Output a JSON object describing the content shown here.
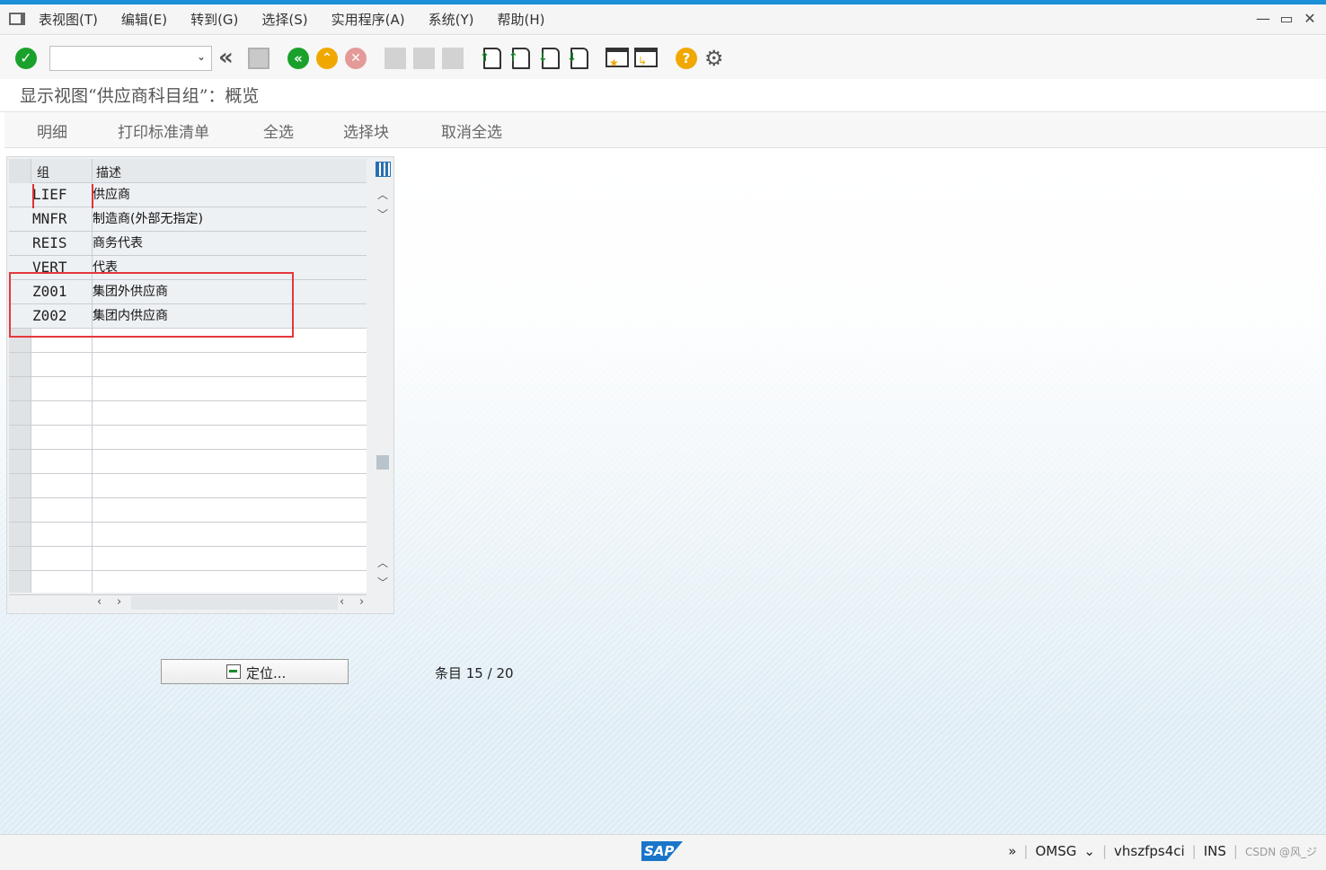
{
  "menubar": {
    "items": [
      "表视图(T)",
      "编辑(E)",
      "转到(G)",
      "选择(S)",
      "实用程序(A)",
      "系统(Y)",
      "帮助(H)"
    ],
    "window_controls": [
      "—",
      "▭",
      "✕"
    ]
  },
  "toolbar": {
    "command_field": {
      "value": "",
      "placeholder": ""
    }
  },
  "title": "显示视图“供应商科目组”：概览",
  "app_toolbar": {
    "buttons": [
      "明细",
      "打印标准清单",
      "全选",
      "选择块",
      "取消全选"
    ]
  },
  "table": {
    "columns": [
      "组",
      "描述"
    ],
    "rows": [
      {
        "group": "LIEF",
        "desc": "供应商"
      },
      {
        "group": "MNFR",
        "desc": "制造商(外部无指定)"
      },
      {
        "group": "REIS",
        "desc": "商务代表"
      },
      {
        "group": "VERT",
        "desc": "代表"
      },
      {
        "group": "Z001",
        "desc": "集团外供应商"
      },
      {
        "group": "Z002",
        "desc": "集团内供应商"
      }
    ],
    "empty_rows": 11
  },
  "locate_button": {
    "label": "定位..."
  },
  "entries_text": "条目 15 / 20",
  "statusbar": {
    "logo": "SAP",
    "expand": "»",
    "transaction": "OMSG",
    "server": "vhszfps4ci",
    "mode": "INS",
    "watermark": "CSDN @风_ジ"
  },
  "colors": {
    "accent_top": "#1a8fd6",
    "highlight_box": "#e5383b",
    "ok_green": "#1aa12c"
  }
}
